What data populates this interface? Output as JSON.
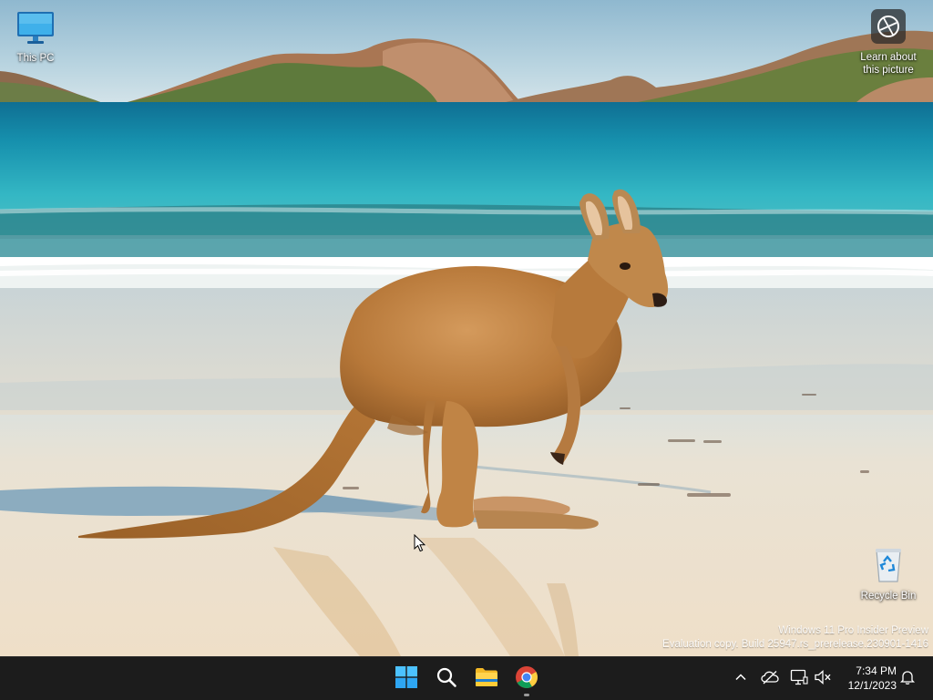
{
  "desktop": {
    "icons": [
      {
        "label": "This PC",
        "icon": "monitor-icon"
      },
      {
        "label": "Recycle Bin",
        "icon": "recycle-bin-icon"
      }
    ],
    "spotlight": {
      "label_line1": "Learn about",
      "label_line2": "this picture",
      "icon": "camera-lens-icon"
    },
    "watermark": {
      "line1": "Windows 11 Pro Insider Preview",
      "line2": "Evaluation copy. Build 25947.rs_prerelease.230901-1416"
    },
    "wallpaper": {
      "scene": "kangaroo-on-beach",
      "sky_color": "#a9c9d9",
      "sea_color": "#1fa3b8",
      "sand_color": "#efe3cf"
    }
  },
  "taskbar": {
    "background": "#1c1c1c",
    "pinned": [
      {
        "name": "Start",
        "icon": "windows-logo-icon"
      },
      {
        "name": "Search",
        "icon": "search-icon"
      },
      {
        "name": "File Explorer",
        "icon": "folder-icon"
      },
      {
        "name": "Google Chrome",
        "icon": "chrome-icon",
        "running": true
      }
    ],
    "tray": {
      "icons": [
        "chevron-up-icon",
        "onedrive-icon",
        "network-icon",
        "volume-muted-icon",
        "bell-icon"
      ],
      "time": "7:34 PM",
      "date": "12/1/2023"
    }
  }
}
